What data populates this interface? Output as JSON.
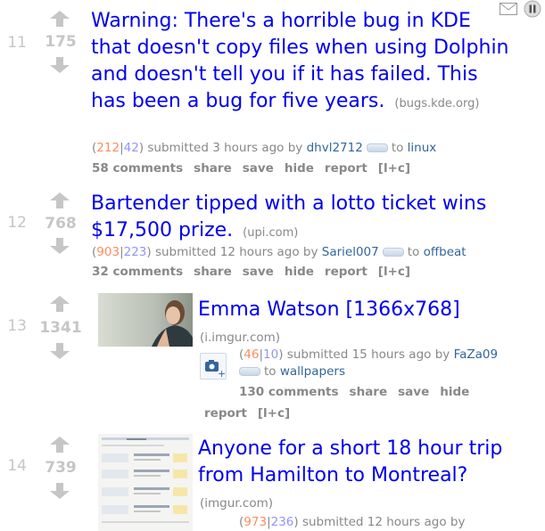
{
  "posts": [
    {
      "rank": "11",
      "score": "175",
      "title": "Warning: There's a horrible bug in KDE that doesn't copy files when using Dolphin and doesn't tell you if it has failed. This has been a bug for five years.",
      "domain": "(bugs.kde.org)",
      "upvotes": "212",
      "downvotes": "42",
      "submitted": "submitted 3 hours ago by",
      "user": "dhvl2712",
      "to": "to",
      "subreddit": "linux",
      "comments": "58 comments",
      "share": "share",
      "save": "save",
      "hide": "hide",
      "report": "report",
      "lc": "[l+c]"
    },
    {
      "rank": "12",
      "score": "768",
      "title": "Bartender tipped with a lotto ticket wins $17,500 prize.",
      "domain": "(upi.com)",
      "upvotes": "903",
      "downvotes": "223",
      "submitted": "submitted 12 hours ago by",
      "user": "Sariel007",
      "to": "to",
      "subreddit": "offbeat",
      "comments": "32 comments",
      "share": "share",
      "save": "save",
      "hide": "hide",
      "report": "report",
      "lc": "[l+c]"
    },
    {
      "rank": "13",
      "score": "1341",
      "title": "Emma Watson [1366x768]",
      "domain": "(i.imgur.com)",
      "upvotes": "46",
      "downvotes": "10",
      "submitted": "submitted 15 hours ago by",
      "user": "FaZa09",
      "to": "to",
      "subreddit": "wallpapers",
      "comments": "130 comments",
      "share": "share",
      "save": "save",
      "hide": "hide",
      "report": "report",
      "lc": "[l+c]"
    },
    {
      "rank": "14",
      "score": "739",
      "title": "Anyone for a short 18 hour trip from Hamilton to Montreal?",
      "domain": "(imgur.com)",
      "upvotes": "973",
      "downvotes": "236",
      "submitted": "submitted 12 hours ago by"
    }
  ],
  "icons": {
    "mail": "mail-icon",
    "pause": "pause-icon",
    "upvote": "upvote-arrow-icon",
    "downvote": "downvote-arrow-icon",
    "expand": "camera-expand-icon"
  },
  "colors": {
    "link": "#0000ee",
    "upvote_count": "#ff8b60",
    "downvote_count": "#9494ff",
    "user": "#336699",
    "meta": "#888888",
    "score": "#c6c6c6"
  }
}
